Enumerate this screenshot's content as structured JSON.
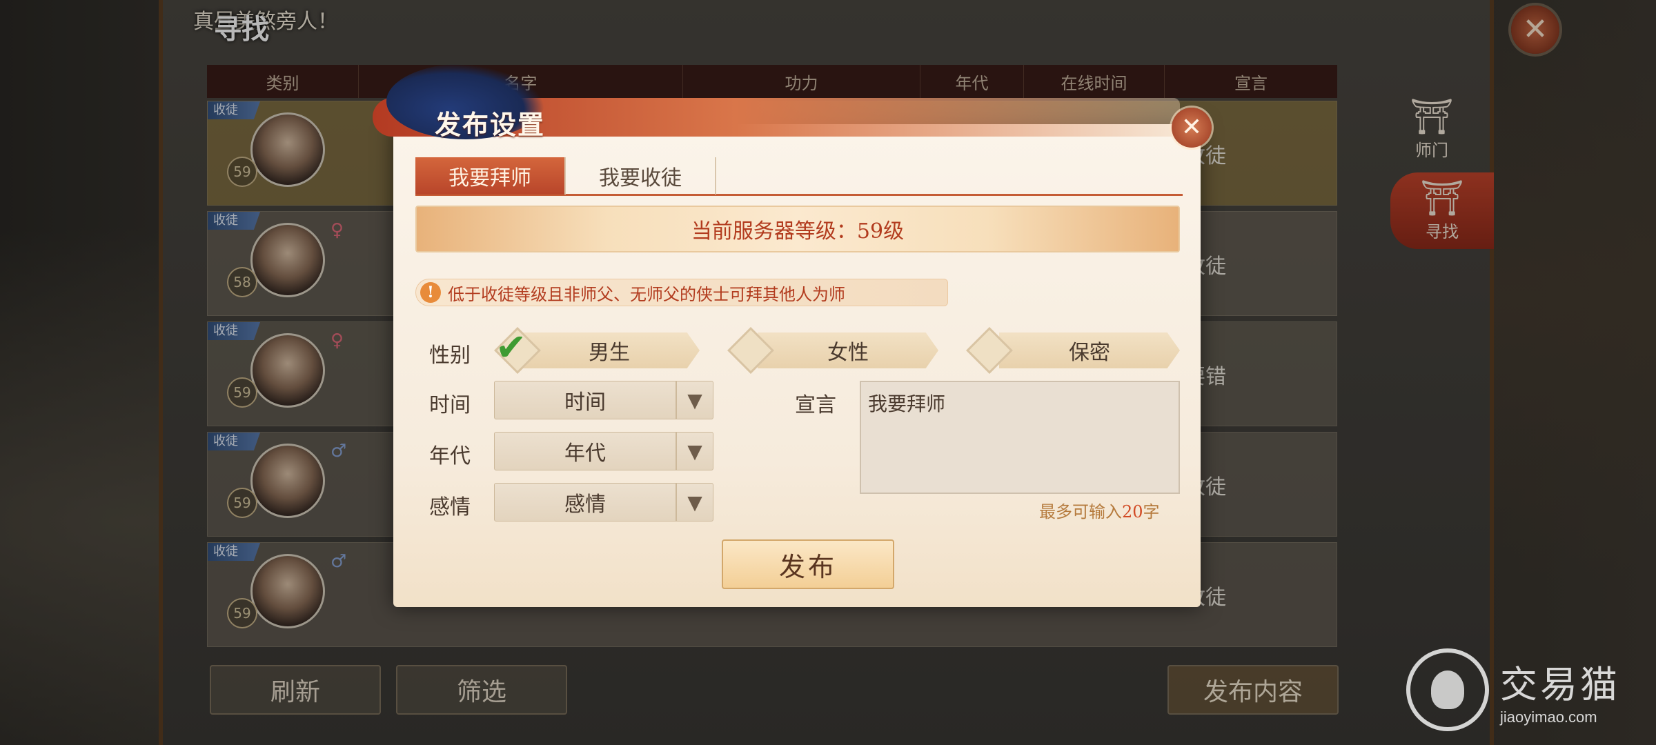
{
  "background": {
    "title_small": "真昼美煞旁人！",
    "title_main": "寻找",
    "close_icon": "close-icon",
    "table_headers": [
      "类别",
      "名字",
      "功力",
      "年代",
      "在线时间",
      "宣言"
    ],
    "rows": [
      {
        "tag": "收徒",
        "level": "59",
        "gender": "",
        "declaration": "要收徒"
      },
      {
        "tag": "收徒",
        "level": "58",
        "gender": "♀",
        "declaration": "要收徒"
      },
      {
        "tag": "收徒",
        "level": "59",
        "gender": "♀",
        "declaration": "过路过不要错"
      },
      {
        "tag": "收徒",
        "level": "59",
        "gender": "♂",
        "declaration": "要收徒"
      },
      {
        "tag": "收徒",
        "level": "59",
        "gender": "♂",
        "declaration": "要收徒"
      }
    ],
    "buttons": {
      "refresh": "刷新",
      "filter": "筛选",
      "publish_content": "发布内容"
    },
    "side_tabs": [
      {
        "icon": "gate-icon",
        "label": "师门"
      },
      {
        "icon": "gate-icon",
        "label": "寻找"
      }
    ],
    "watermark": {
      "cn": "交易猫",
      "en": "jiaoyimao.com"
    }
  },
  "modal": {
    "title": "发布设置",
    "close_icon": "close-icon",
    "tabs": [
      {
        "label": "我要拜师",
        "active": true
      },
      {
        "label": "我要收徒",
        "active": false
      }
    ],
    "server_level": "当前服务器等级：59级",
    "notice": "低于收徒等级且非师父、无师父的侠士可拜其他人为师",
    "notice_icon": "!",
    "gender": {
      "label": "性别",
      "options": [
        {
          "label": "男生",
          "selected": true
        },
        {
          "label": "女性",
          "selected": false
        },
        {
          "label": "保密",
          "selected": false
        }
      ]
    },
    "time": {
      "label": "时间",
      "value": "时间"
    },
    "era": {
      "label": "年代",
      "value": "年代"
    },
    "emotion": {
      "label": "感情",
      "value": "感情"
    },
    "declaration": {
      "label": "宣言",
      "value": "我要拜师"
    },
    "limit_prefix": "最多可输入",
    "limit_num": "20",
    "limit_suffix": "字",
    "publish": "发布",
    "check_glyph": "✔",
    "arrow_glyph": "▼"
  }
}
